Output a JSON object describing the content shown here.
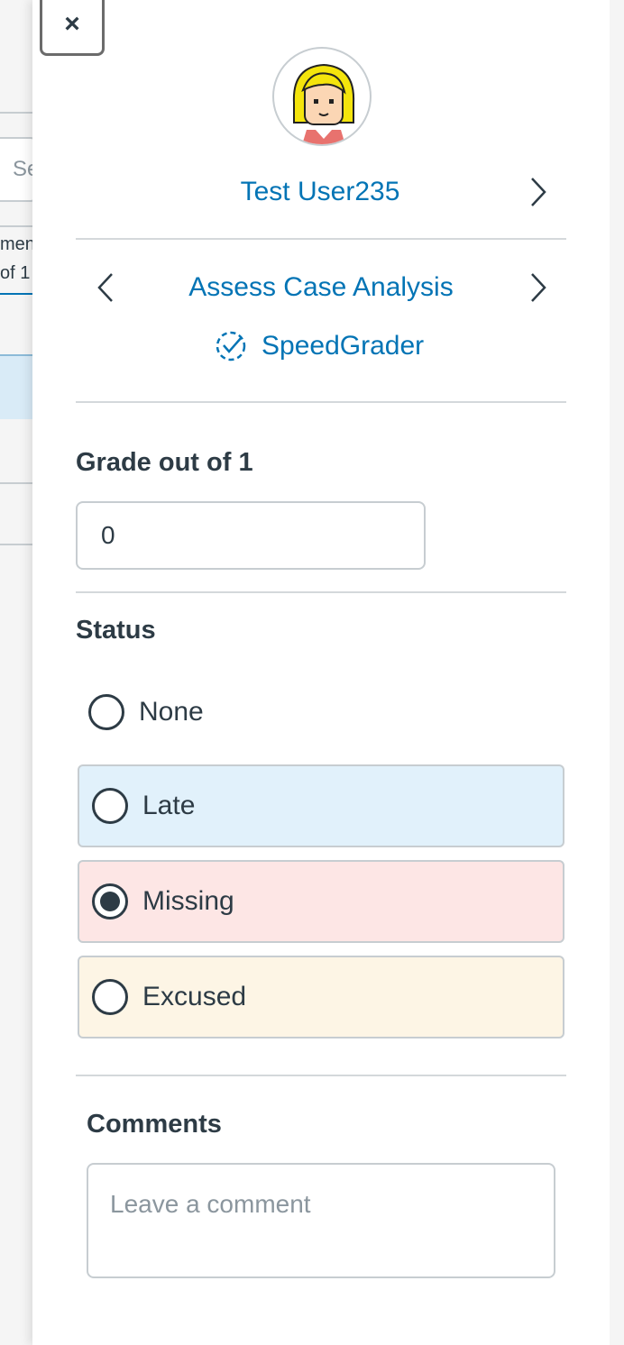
{
  "background": {
    "search_fragment": "Se",
    "text_line_1": "men",
    "text_line_2": "of 1"
  },
  "tray": {
    "close_label": "×",
    "student": {
      "name": "Test User235"
    },
    "assignment": {
      "name": "Assess Case Analysis",
      "speedgrader_label": "SpeedGrader"
    },
    "grade": {
      "label": "Grade out of 1",
      "value": "0"
    },
    "status": {
      "label": "Status",
      "options": [
        {
          "label": "None",
          "checked": false,
          "color": "#ffffff"
        },
        {
          "label": "Late",
          "checked": false,
          "color": "#e1f1fb"
        },
        {
          "label": "Missing",
          "checked": true,
          "color": "#fde6e5"
        },
        {
          "label": "Excused",
          "checked": false,
          "color": "#fdf5e5"
        }
      ]
    },
    "comments": {
      "label": "Comments",
      "placeholder": "Leave a comment"
    }
  },
  "colors": {
    "link": "#0374b5",
    "text": "#2d3b45",
    "border": "#c7cdd1"
  }
}
